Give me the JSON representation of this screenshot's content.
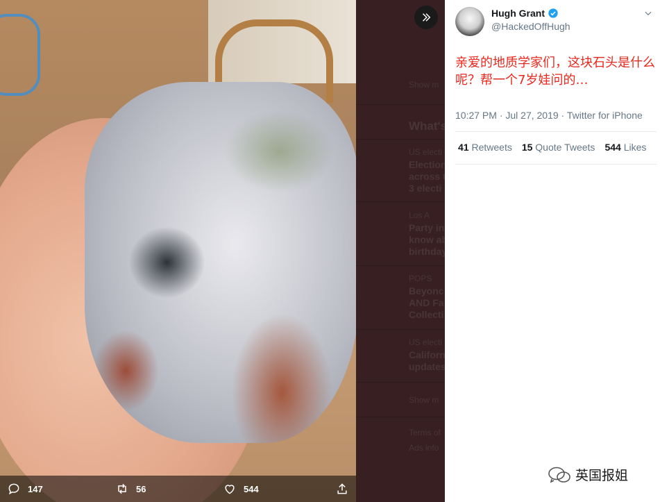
{
  "tweet": {
    "display_name": "Hugh Grant",
    "handle": "@HackedOffHugh",
    "text": "亲爱的地质学家们，这块石头是什么呢？帮一个7岁娃问的…",
    "timestamp": "10:27 PM · Jul 27, 2019 · Twitter for iPhone",
    "retweets_count": "41",
    "retweets_label": "Retweets",
    "quote_count": "15",
    "quote_label": "Quote Tweets",
    "likes_count": "544",
    "likes_label": "Likes"
  },
  "media_actions": {
    "replies": "147",
    "retweets": "56",
    "likes": "544"
  },
  "background_column": {
    "show_more_1": "Show m",
    "whats_header": "What's",
    "trend1_category": "US electi",
    "trend1_lines": [
      "Election",
      "across t",
      "3 electi"
    ],
    "trend2_source": "Los A",
    "trend2_lines": [
      "Party in",
      "know ab",
      "birthday"
    ],
    "trend3_source": "POPS",
    "trend3_lines": [
      "Beyonc",
      "AND Fa",
      "Collecti"
    ],
    "trend4_category": "US electi",
    "trend4_lines": [
      "Californ",
      "updates"
    ],
    "show_more_2": "Show m",
    "footer1": "Terms of",
    "footer2": "Ads info"
  },
  "watermark": {
    "text": "英国报姐"
  },
  "colors": {
    "tweet_text": "#e8281e",
    "verified": "#1da1f2"
  }
}
